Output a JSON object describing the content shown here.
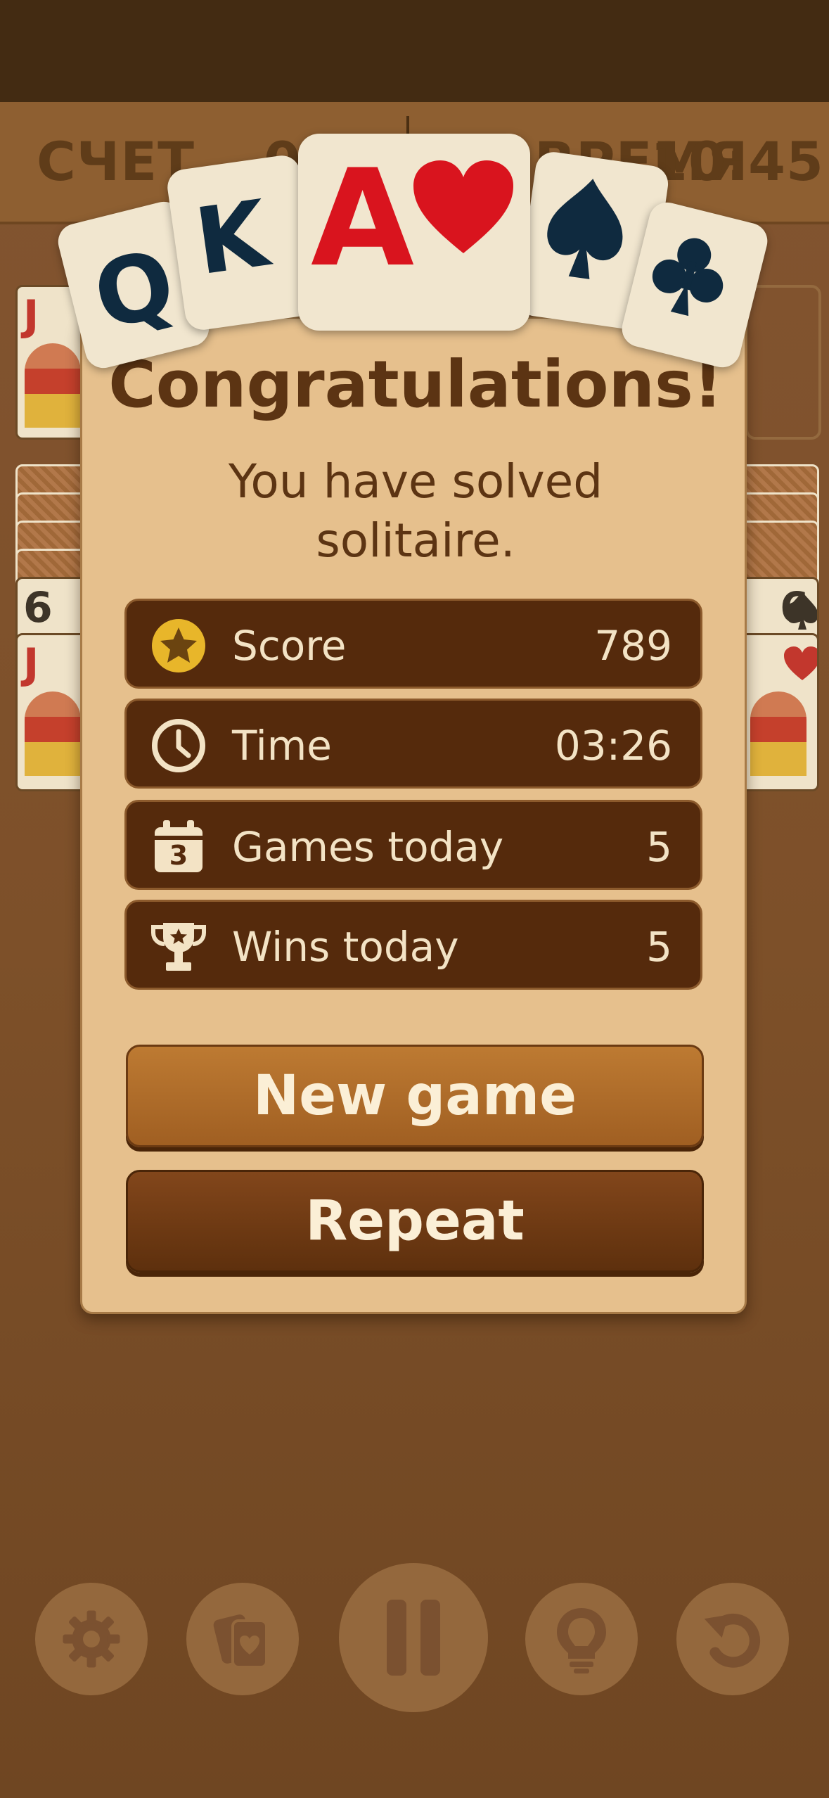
{
  "top_bar": {
    "score_label": "СЧЕТ",
    "score_value": "0",
    "time_label": "ВРЕМЯ",
    "time_value": "10:45"
  },
  "header_cards": {
    "queen": "Q",
    "king": "K",
    "ace": "A"
  },
  "background_cards": {
    "jack_rank": "J",
    "six_rank": "6",
    "right_six_rank": "6"
  },
  "dialog": {
    "title": "Congratulations!",
    "subtitle": "You have solved solitaire.",
    "stats": [
      {
        "icon": "star-icon",
        "label": "Score",
        "value": "789"
      },
      {
        "icon": "clock-icon",
        "label": "Time",
        "value": "03:26"
      },
      {
        "icon": "calendar-icon",
        "label": "Games today",
        "value": "5",
        "icon_text": "3"
      },
      {
        "icon": "trophy-icon",
        "label": "Wins today",
        "value": "5"
      }
    ],
    "new_game_label": "New game",
    "repeat_label": "Repeat"
  },
  "bottom_bar": [
    {
      "icon": "gear-icon"
    },
    {
      "icon": "cards-icon"
    },
    {
      "icon": "pause-icon"
    },
    {
      "icon": "lightbulb-icon"
    },
    {
      "icon": "undo-icon"
    }
  ],
  "colors": {
    "dialog_bg": "#e6c08d",
    "stat_row_bg": "#552a0c",
    "new_game_bg": "#a86a2b",
    "repeat_bg": "#6e3a13",
    "heart_red": "#d9141e",
    "spade_navy": "#0f2a3f",
    "star_gold": "#e8b62a"
  }
}
